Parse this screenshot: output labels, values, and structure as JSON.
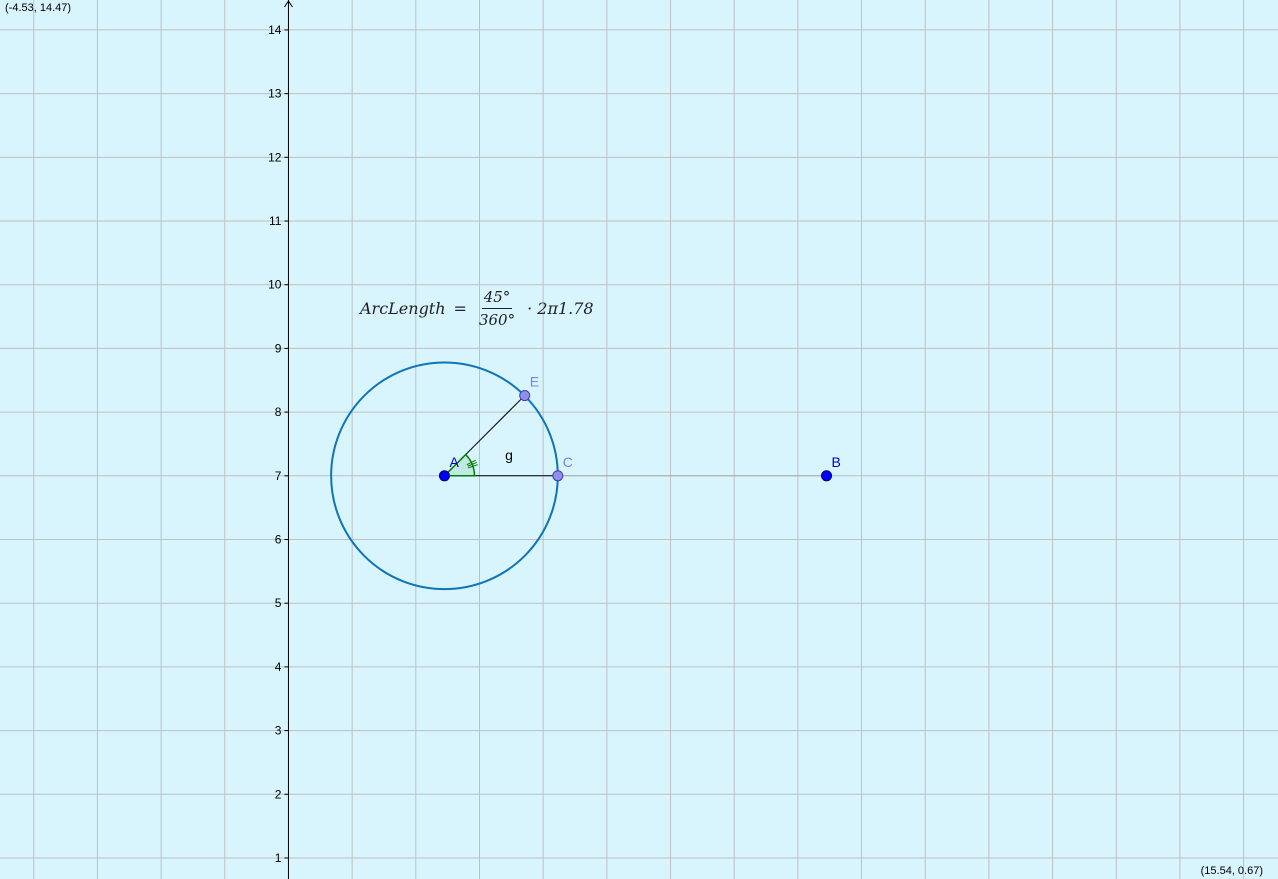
{
  "view": {
    "xmin": -4.53,
    "ymax": 14.47,
    "xmax": 15.54,
    "ymin": 0.67,
    "top_left_label": "(-4.53, 14.47)",
    "bottom_right_label": "(15.54, 0.67)"
  },
  "y_axis_ticks": [
    "1",
    "2",
    "3",
    "4",
    "5",
    "6",
    "7",
    "8",
    "9",
    "10",
    "11",
    "12",
    "13",
    "14"
  ],
  "colors": {
    "background": "#d8f4fd",
    "grid": "#c0c0c0",
    "circle": "#1074b5",
    "point_dark": "#0000ff",
    "point_light": "#8f8fef",
    "label_dark": "#0000c8",
    "label_light": "#8080e0",
    "angle": "#007f00"
  },
  "points": [
    {
      "id": "A",
      "label": "A",
      "x": 2.45,
      "y": 7.0,
      "style": "dark"
    },
    {
      "id": "B",
      "label": "B",
      "x": 8.45,
      "y": 7.0,
      "style": "dark"
    },
    {
      "id": "C",
      "label": "C",
      "x": 4.23,
      "y": 7.0,
      "style": "light"
    },
    {
      "id": "E",
      "label": "E",
      "x": 3.71,
      "y": 8.26,
      "style": "light"
    }
  ],
  "circle": {
    "center": "A",
    "radius": 1.78
  },
  "segment_label": "g",
  "formula": {
    "lhs": "ArcLength",
    "equals": "=",
    "numerator": "45°",
    "denominator": "360°",
    "tail": "· 2π1.78"
  }
}
